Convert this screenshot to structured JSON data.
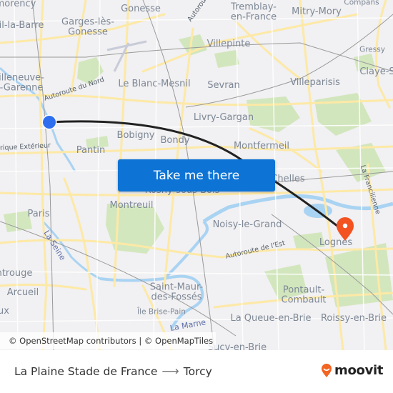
{
  "map": {
    "places": [
      {
        "id": "montmorency",
        "label": "morency",
        "size": "md"
      },
      {
        "id": "gonesse",
        "label": "Gonesse",
        "size": "md"
      },
      {
        "id": "tremblay",
        "label": "Tremblay-\nen-France",
        "size": "md"
      },
      {
        "id": "mitry-mory",
        "label": "Mitry-Mory",
        "size": "md"
      },
      {
        "id": "compans",
        "label": "Compans",
        "size": "sm"
      },
      {
        "id": "deuil-la-barre",
        "label": "il-la-Barre",
        "size": "md"
      },
      {
        "id": "garges",
        "label": "Garges-lès-\nGonesse",
        "size": "md"
      },
      {
        "id": "villepinte",
        "label": "Villepinte",
        "size": "md"
      },
      {
        "id": "gressy",
        "label": "Gressy",
        "size": "sm"
      },
      {
        "id": "claye-souilly",
        "label": "Claye-S",
        "size": "md"
      },
      {
        "id": "villeneuve",
        "label": "illeneuve-\n-Garenne",
        "size": "md"
      },
      {
        "id": "le-blanc-mesnil",
        "label": "Le Blanc-Mesnil",
        "size": "md"
      },
      {
        "id": "sevran",
        "label": "Sevran",
        "size": "md"
      },
      {
        "id": "villeparisis",
        "label": "Villeparisis",
        "size": "md"
      },
      {
        "id": "livry-gargan",
        "label": "Livry-Gargan",
        "size": "md"
      },
      {
        "id": "bobigny",
        "label": "Bobigny",
        "size": "md"
      },
      {
        "id": "bondy",
        "label": "Bondy",
        "size": "md"
      },
      {
        "id": "montfermeil",
        "label": "Montfermeil",
        "size": "md"
      },
      {
        "id": "pantin",
        "label": "Pantin",
        "size": "md"
      },
      {
        "id": "chelles",
        "label": "Chelles",
        "size": "md"
      },
      {
        "id": "rosny",
        "label": "Rosny-sous-Bois",
        "size": "md"
      },
      {
        "id": "montreuil",
        "label": "Montreuil",
        "size": "md"
      },
      {
        "id": "paris",
        "label": "Paris",
        "size": "md"
      },
      {
        "id": "noisy-le-grand",
        "label": "Noisy-le-Grand",
        "size": "md"
      },
      {
        "id": "lognes",
        "label": "Lognes",
        "size": "md"
      },
      {
        "id": "gentilly",
        "label": "ntrouge",
        "size": "md"
      },
      {
        "id": "arcueil",
        "label": "Arcueil",
        "size": "md"
      },
      {
        "id": "fresnes",
        "label": "ux",
        "size": "md"
      },
      {
        "id": "saint-maur",
        "label": "Saint-Maur-\ndes-Fossés",
        "size": "md"
      },
      {
        "id": "ile-brise-pain",
        "label": "Île Brise-Pain",
        "size": "sm"
      },
      {
        "id": "pontault",
        "label": "Pontault-\nCombault",
        "size": "md"
      },
      {
        "id": "la-queue-en-brie",
        "label": "La Queue-en-Brie",
        "size": "md"
      },
      {
        "id": "roissy-en-brie",
        "label": "Roissy-en-Brie",
        "size": "md"
      },
      {
        "id": "sucy-en-brie",
        "label": "Sucy-en-Brie",
        "size": "md"
      }
    ],
    "roads": [
      {
        "id": "autoroute-du-nord",
        "label": "Autoroute du Nord"
      },
      {
        "id": "autoroute-a1-top",
        "label": "Autoroute"
      },
      {
        "id": "peripherique",
        "label": "rique Extérieur"
      },
      {
        "id": "autoroute-de-l-est",
        "label": "Autoroute de l'Est"
      },
      {
        "id": "la-francilienne",
        "label": "La Francilienne"
      }
    ],
    "water": [
      {
        "id": "la-seine",
        "label": "La Seine"
      },
      {
        "id": "la-marne",
        "label": "La Marne"
      }
    ],
    "origin": {
      "name": "La Plaine Stade de France",
      "color": "#2f6fef"
    },
    "destination": {
      "name": "Torcy",
      "color": "#f35221"
    },
    "route_color": "#222222",
    "cta_label": "Take me there",
    "attribution": "© OpenStreetMap contributors | © OpenMapTiles"
  },
  "footer": {
    "origin": "La Plaine Stade de France",
    "arrow": "⟶",
    "destination": "Torcy",
    "brand": "moovit",
    "brand_color": "#f26522"
  }
}
